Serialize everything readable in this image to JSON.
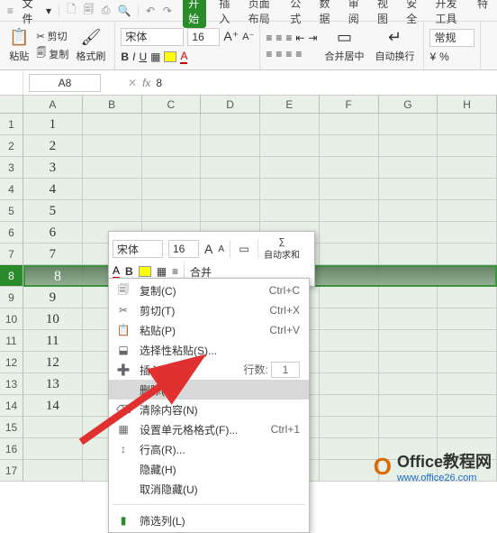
{
  "menubar": {
    "file": "文件",
    "dropdown": "▾"
  },
  "tabs": {
    "t0": "开始",
    "t1": "插入",
    "t2": "页面布局",
    "t3": "公式",
    "t4": "数据",
    "t5": "审阅",
    "t6": "视图",
    "t7": "安全",
    "t8": "开发工具",
    "t9": "特"
  },
  "ribbon": {
    "paste": "粘贴",
    "cut": "剪切",
    "copy": "复制",
    "format_painter": "格式刷",
    "font": "宋体",
    "size": "16",
    "merge": "合并居中",
    "wrap": "自动换行",
    "numfmt": "常规"
  },
  "namebox": "A8",
  "formula": "8",
  "cols": [
    "A",
    "B",
    "C",
    "D",
    "E",
    "F",
    "G",
    "H"
  ],
  "rows": [
    "1",
    "2",
    "3",
    "4",
    "5",
    "6",
    "7",
    "8",
    "9",
    "10",
    "11",
    "12",
    "13",
    "14",
    "15",
    "16",
    "17"
  ],
  "data": [
    "1",
    "2",
    "3",
    "4",
    "5",
    "6",
    "7",
    "8",
    "9",
    "10",
    "11",
    "12",
    "13",
    "14"
  ],
  "mini": {
    "font": "宋体",
    "size": "16",
    "A_big": "A",
    "A_small": "A",
    "merge": "合并",
    "sum": "自动求和",
    "bold": "B",
    "fill": "▢"
  },
  "ctx": {
    "copy": "复制(C)",
    "sc_copy": "Ctrl+C",
    "cut": "剪切(T)",
    "sc_cut": "Ctrl+X",
    "paste": "粘贴(P)",
    "sc_paste": "Ctrl+V",
    "paste_special": "选择性粘贴(S)...",
    "insert": "插入(I)",
    "rows_lbl": "行数:",
    "rows_val": "1",
    "delete": "删除(D)",
    "clear": "清除内容(N)",
    "format_cells": "设置单元格格式(F)...",
    "sc_fc": "Ctrl+1",
    "row_height": "行高(R)...",
    "hide": "隐藏(H)",
    "unhide": "取消隐藏(U)",
    "filter": "筛选列(L)"
  },
  "watermark": {
    "brand": "Office教程网",
    "url": "www.office26.com"
  }
}
